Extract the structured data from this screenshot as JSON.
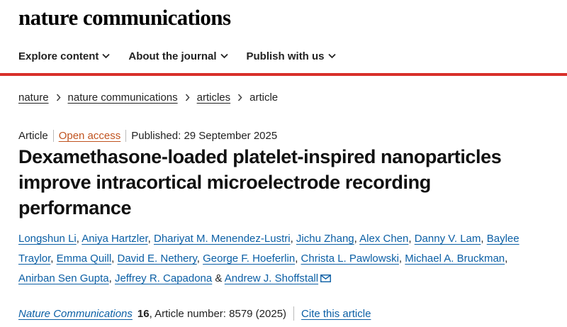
{
  "site": {
    "logo": "nature communications"
  },
  "nav": {
    "items": [
      {
        "label": "Explore content"
      },
      {
        "label": "About the journal"
      },
      {
        "label": "Publish with us"
      }
    ]
  },
  "colors": {
    "accent_rule": "#d82f2a",
    "link": "#0b5fa5",
    "open_access": "#c0531f"
  },
  "breadcrumb": {
    "items": [
      "nature",
      "nature communications",
      "articles"
    ],
    "current": "article"
  },
  "article": {
    "type": "Article",
    "access": "Open access",
    "published": "Published: 29 September 2025",
    "title": "Dexamethasone-loaded platelet-inspired nanoparticles improve intracortical microelectrode recording performance",
    "authors": [
      "Longshun Li",
      "Aniya Hartzler",
      "Dhariyat M. Menendez-Lustri",
      "Jichu Zhang",
      "Alex Chen",
      "Danny V. Lam",
      "Baylee Traylor",
      "Emma Quill",
      "David E. Nethery",
      "George F. Hoeferlin",
      "Christa L. Pawlowski",
      "Michael A. Bruckman",
      "Anirban Sen Gupta",
      "Jeffrey R. Capadona",
      "Andrew J. Shoffstall"
    ],
    "and_text": "&",
    "corresponding_icon": "mail-icon"
  },
  "citation": {
    "journal": "Nature Communications",
    "volume": "16",
    "article_number": ", Article number: 8579 (2025)",
    "cite_link": "Cite this article"
  }
}
